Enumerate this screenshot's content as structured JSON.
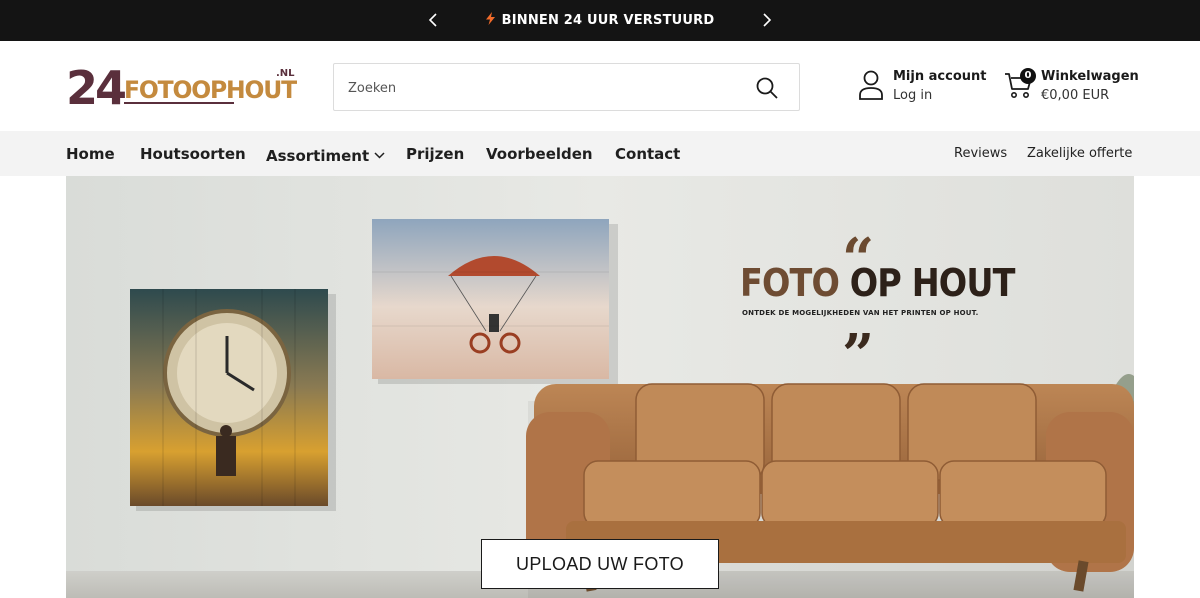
{
  "announcement": {
    "message": "BINNEN 24 UUR VERSTUURD",
    "prev_icon": "chevron-left-icon",
    "next_icon": "chevron-right-icon",
    "bolt_color": "#f26b2a"
  },
  "header": {
    "logo": {
      "digits": "24",
      "name": "FOTOOPHOUT",
      "tld": ".NL",
      "digits_color": "#5a2f3c",
      "name_color": "#c48a3e"
    },
    "search": {
      "placeholder": "Zoeken",
      "icon": "search-icon"
    },
    "account": {
      "title": "Mijn account",
      "subtitle": "Log in",
      "icon": "user-icon"
    },
    "cart": {
      "title": "Winkelwagen",
      "amount": "€0,00 EUR",
      "count": "0",
      "icon": "cart-icon"
    }
  },
  "nav": {
    "items": [
      {
        "label": "Home"
      },
      {
        "label": "Houtsoorten"
      },
      {
        "label": "Assortiment",
        "has_dropdown": true
      },
      {
        "label": "Prijzen"
      },
      {
        "label": "Voorbeelden"
      },
      {
        "label": "Contact"
      }
    ],
    "secondary": [
      {
        "label": "Reviews"
      },
      {
        "label": "Zakelijke offerte"
      }
    ]
  },
  "hero": {
    "quote_open": "“",
    "headline_part1": "FOTO ",
    "headline_part2": "OP HOUT",
    "subline": "ONTDEK DE MOGELIJKHEDEN VAN HET PRINTEN OP HOUT.",
    "quote_close": "”",
    "cta_label": "UPLOAD UW FOTO",
    "accent_brown": "#6e4c33",
    "dark_brown": "#2d2119",
    "sofa_color": "#b0784a"
  }
}
